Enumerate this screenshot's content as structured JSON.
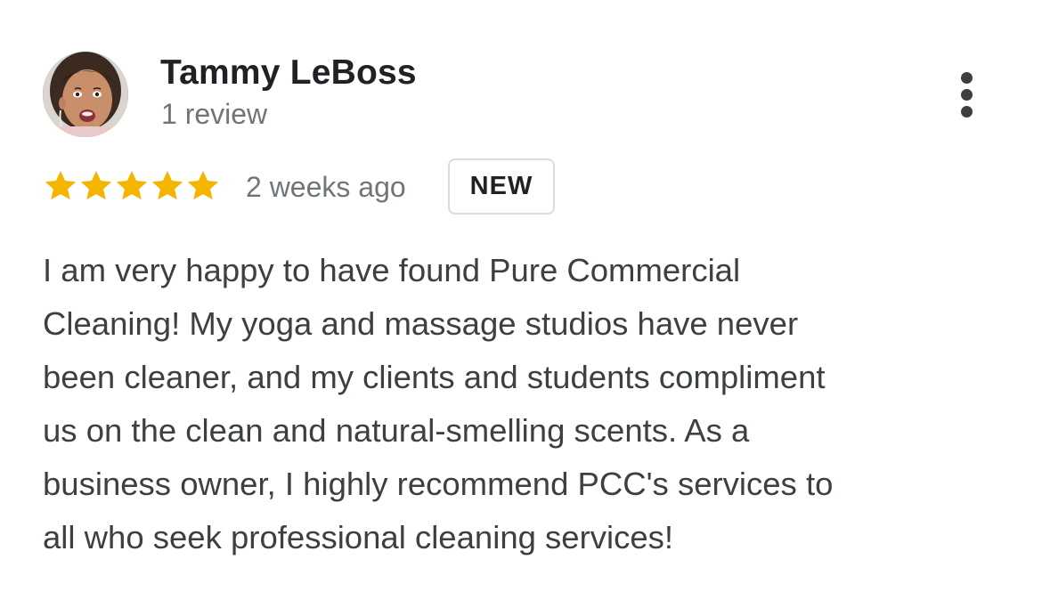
{
  "review": {
    "reviewer_name": "Tammy LeBoss",
    "review_count": "1 review",
    "rating": 5,
    "rating_max": 5,
    "date": "2 weeks ago",
    "badge": "NEW",
    "text_lines": [
      "I am very happy to have found Pure Commercial",
      "Cleaning! My yoga and massage studios have never",
      "been cleaner, and my clients and students compliment",
      "us on the clean and natural-smelling scents. As a",
      "business owner, I highly recommend PCC's services to",
      "all who seek professional cleaning services!"
    ]
  },
  "icons": {
    "more": "more-vert-icon",
    "star": "star-icon",
    "avatar": "user-avatar"
  },
  "colors": {
    "star": "#F4B400",
    "name": "#202124",
    "secondary": "#70757a",
    "body_text": "#3c4043",
    "badge_border": "#dadce0"
  }
}
